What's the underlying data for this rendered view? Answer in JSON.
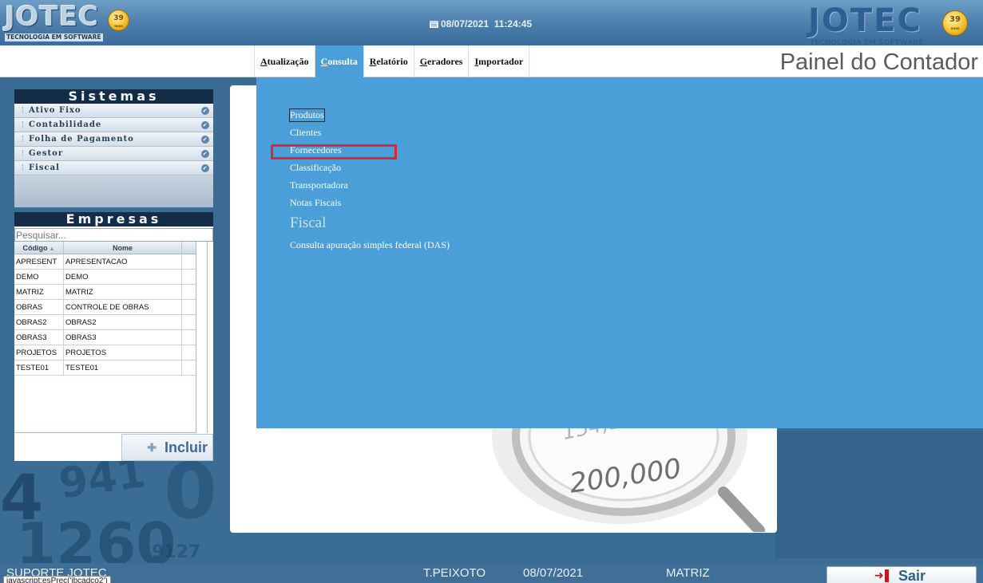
{
  "header": {
    "brand": "JOTEC",
    "brand_tagline": "TECNOLOGIA EM SOFTWARE",
    "badge_number": "39",
    "badge_sub": "anos",
    "date": "08/07/2021",
    "time": "11:24:45"
  },
  "menu": {
    "items": [
      {
        "accel": "A",
        "rest": "tualização"
      },
      {
        "accel": "C",
        "rest": "onsulta"
      },
      {
        "accel": "R",
        "rest": "elatório"
      },
      {
        "accel": "G",
        "rest": "eradores"
      },
      {
        "accel": "I",
        "rest": "mportador"
      }
    ],
    "active_index": 1
  },
  "page_title": "Painel do Contador",
  "sistemas": {
    "title": "Sistemas",
    "items": [
      "Ativo Fixo",
      "Contabilidade",
      "Folha de Pagamento",
      "Gestor",
      "Fiscal"
    ]
  },
  "empresas": {
    "title": "Empresas",
    "search_placeholder": "Pesquisar...",
    "columns": [
      "Código",
      "Nome"
    ],
    "rows": [
      [
        "APRESENT",
        "APRESENTACAO"
      ],
      [
        "DEMO",
        "DEMO"
      ],
      [
        "MATRIZ",
        "MATRIZ"
      ],
      [
        "OBRAS",
        "CONTROLE DE OBRAS"
      ],
      [
        "OBRAS2",
        "OBRAS2"
      ],
      [
        "OBRAS3",
        "OBRAS3"
      ],
      [
        "PROJETOS",
        "PROJETOS"
      ],
      [
        "TESTE01",
        "TESTE01"
      ]
    ],
    "add_button": "Incluir"
  },
  "consulta_menu": {
    "items": [
      "Produtos",
      "Clientes",
      "Fornecedores",
      "Classificação",
      "Transportadora",
      "Notas Fiscais"
    ],
    "section_title": "Fiscal",
    "section_items": [
      "Consulta apuração simples federal (DAS)"
    ],
    "focused_item": "Produtos",
    "highlighted_item": "Fornecedores"
  },
  "background_text": {
    "loupe_number_1": "154,1",
    "loupe_number_2": "200,000"
  },
  "status": {
    "user_left": "SUPORTE JOTEC",
    "user": "T.PEIXOTO",
    "date": "08/07/2021",
    "company": "MATRIZ",
    "exit_button": "Sair",
    "tooltip": "javascript:esPrec('ibcadco2')"
  },
  "colors": {
    "accent": "#4a9fd8",
    "header": "#4b7dab",
    "highlight": "#e3222e"
  }
}
